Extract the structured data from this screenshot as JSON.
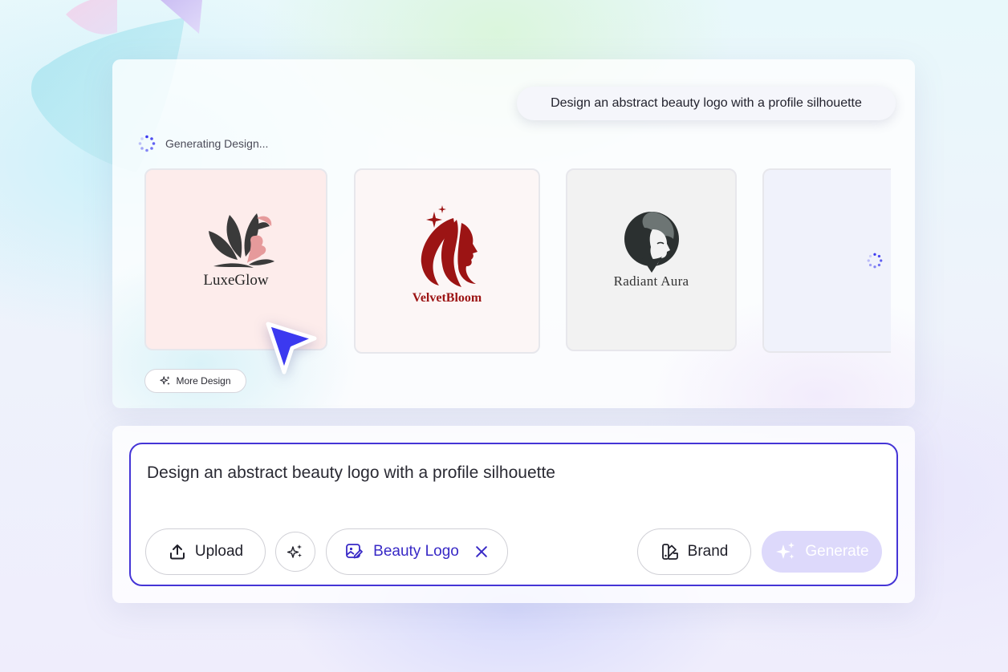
{
  "conversation": {
    "user_prompt": "Design an abstract beauty logo with a profile silhouette"
  },
  "status": {
    "label": "Generating Design...",
    "icon": "spinner-icon"
  },
  "designs": [
    {
      "brand_name": "LuxeGlow",
      "icon": "leaf-face-logo",
      "accent": "#e69a9b"
    },
    {
      "brand_name": "VelvetBloom",
      "icon": "flowing-hair-profile-logo",
      "accent": "#9c1414"
    },
    {
      "brand_name": "Radiant Aura",
      "icon": "circle-face-profile-logo",
      "accent": "#2b3030"
    },
    {
      "brand_name": "",
      "icon": "loading-spinner",
      "state": "loading"
    }
  ],
  "more_design": {
    "label": "More Design",
    "icon": "sparkle-icon"
  },
  "composer": {
    "prompt_text": "Design an abstract beauty logo with a profile silhouette",
    "upload_label": "Upload",
    "magic_icon": "sparkle-icon",
    "tag_label": "Beauty Logo",
    "tag_icon": "image-edit-icon",
    "brand_label": "Brand",
    "brand_icon": "palette-swatch-icon",
    "generate_label": "Generate",
    "generate_icon": "sparkle-icon"
  },
  "colors": {
    "accent": "#4535d6",
    "accent_light": "#ddd9fb",
    "cursor": "#3b39f0"
  }
}
